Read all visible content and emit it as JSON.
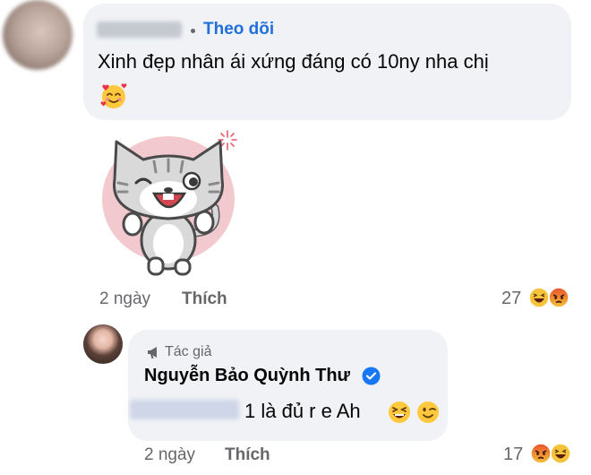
{
  "comment": {
    "follow_label": "Theo dõi",
    "text": "Xinh đẹp nhân ái xứng đáng có 10ny nha chị",
    "time": "2 ngày",
    "like_label": "Thích",
    "reaction_count": "27"
  },
  "reply": {
    "author_label": "Tác giả",
    "author_name": "Nguyễn Bảo Quỳnh Thư",
    "text": "1 là đủ r e Ah",
    "time": "2 ngày",
    "like_label": "Thích",
    "reaction_count": "17"
  },
  "colors": {
    "link": "#216fdb",
    "bubble": "#f0f2f5",
    "meta": "#65676b",
    "verified": "#1877f2"
  },
  "icons": {
    "comment_emoji": "smiling-face-with-hearts-icon",
    "sticker": "winking-cat-sticker",
    "reply_emojis": [
      "laughing-face-icon",
      "winking-face-icon"
    ],
    "reactions": [
      "haha-reaction-icon",
      "angry-reaction-icon"
    ]
  }
}
